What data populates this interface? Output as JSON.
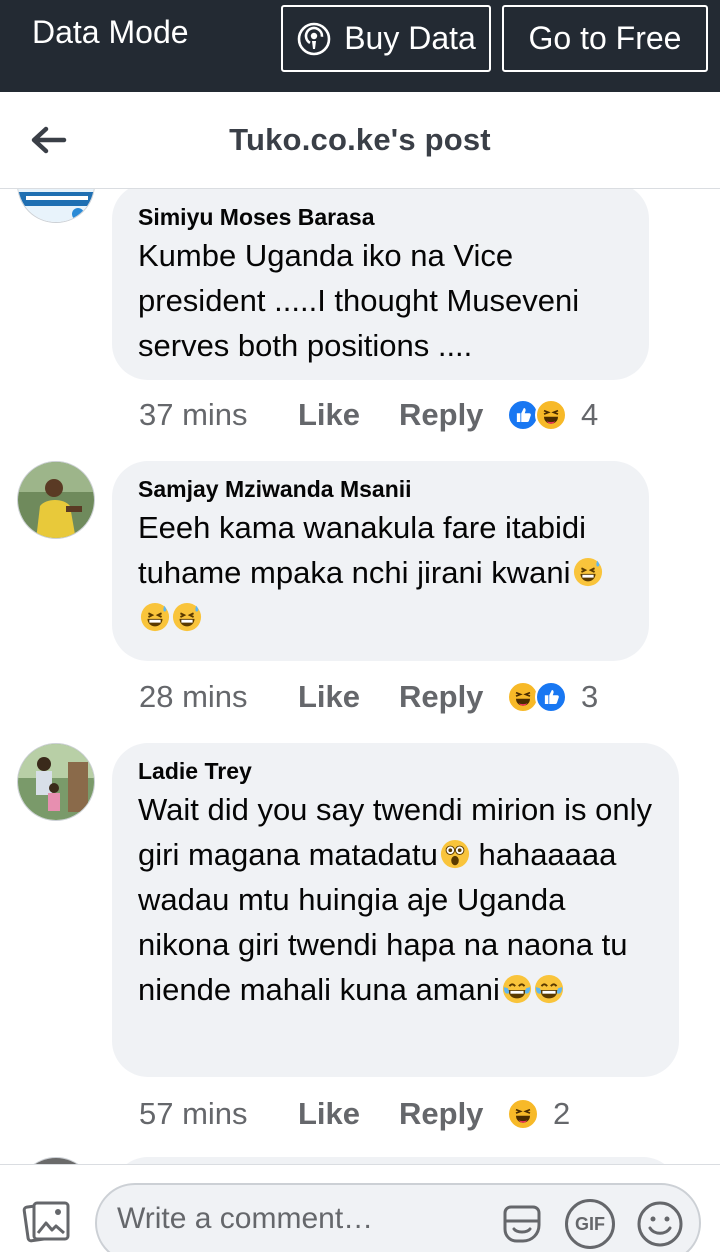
{
  "databar": {
    "mode_label": "Data Mode",
    "buy_label": "Buy Data",
    "free_label": "Go to Free"
  },
  "header": {
    "title": "Tuko.co.ke's post"
  },
  "comments": [
    {
      "author": "Simiyu Moses Barasa",
      "text": "Kumbe Uganda iko na Vice president .....I thought Museveni serves both positions ....",
      "time": "37 mins",
      "like_label": "Like",
      "reply_label": "Reply",
      "reactions": [
        "like",
        "haha"
      ],
      "reaction_count": "4"
    },
    {
      "author": "Samjay Mziwanda Msanii",
      "text": "Eeeh kama wanakula fare itabidi tuhame mpaka nchi jirani kwani",
      "emojis": [
        "grinning-sweat",
        "grinning-sweat",
        "grinning-sweat"
      ],
      "time": "28 mins",
      "like_label": "Like",
      "reply_label": "Reply",
      "reactions": [
        "haha",
        "like"
      ],
      "reaction_count": "3"
    },
    {
      "author": "Ladie Trey",
      "text_part1": "Wait did you say twendi mirion is only giri magana matadatu",
      "text_part2": "hahaaaaa wadau mtu huingia aje Uganda nikona giri twendi hapa na naona tu niende mahali kuna amani",
      "emojis_mid": [
        "astonished"
      ],
      "emojis_end": [
        "tears-of-joy",
        "tears-of-joy"
      ],
      "time": "57 mins",
      "like_label": "Like",
      "reply_label": "Reply",
      "reactions": [
        "haha"
      ],
      "reaction_count": "2"
    }
  ],
  "composer": {
    "placeholder": "Write a comment…",
    "gif_label": "GIF"
  },
  "colors": {
    "databar_bg": "#232a33",
    "bubble_bg": "#f0f2f5",
    "like_blue": "#1877f2",
    "haha_yellow": "#f7b928",
    "muted_text": "#65676b"
  }
}
